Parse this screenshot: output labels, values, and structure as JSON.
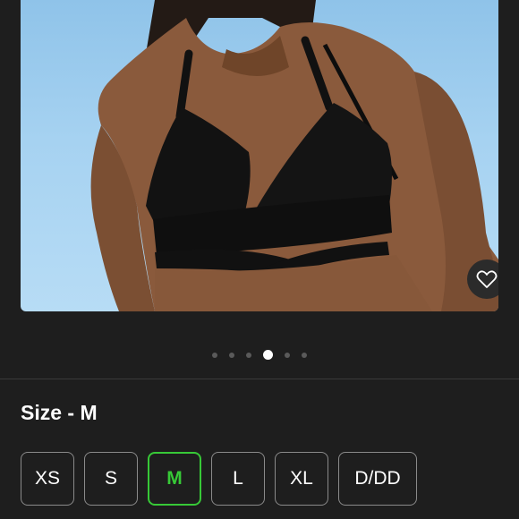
{
  "product": {
    "image_alt": "Black triangle bikini top with cut-out wrap band",
    "favorite_icon": "heart-icon"
  },
  "carousel": {
    "total": 6,
    "active_index": 3
  },
  "size_section": {
    "title": "Size - M",
    "options": [
      "XS",
      "S",
      "M",
      "L",
      "XL",
      "D/DD"
    ],
    "selected": "M"
  },
  "colors": {
    "background": "#1e1e1e",
    "selected_accent": "#37c937",
    "border": "#8a8a8a",
    "sky": "#a6d2f1"
  }
}
